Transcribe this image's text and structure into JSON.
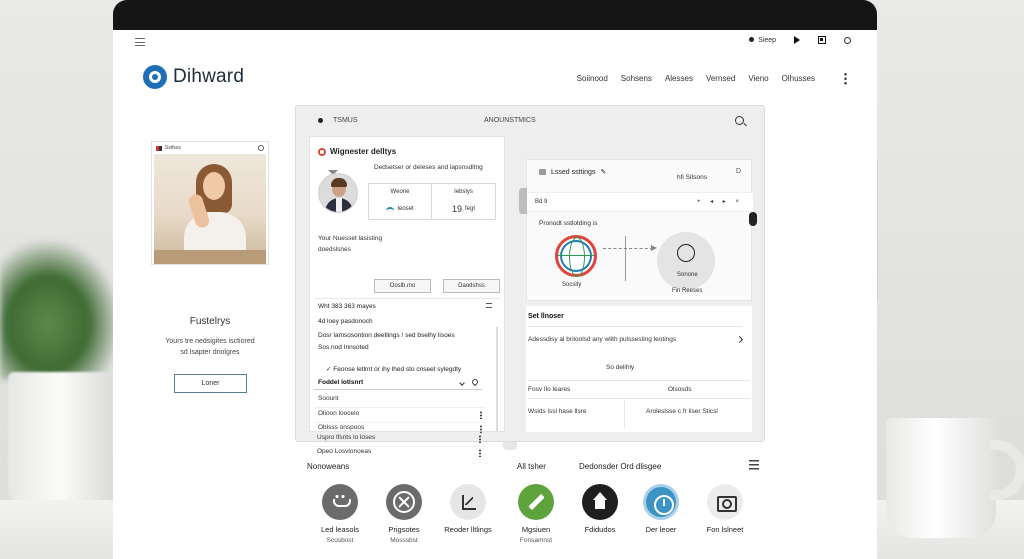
{
  "top_controls": {
    "status_label": "Sieep"
  },
  "header": {
    "brand": "Dihward",
    "nav": [
      "Soiinood",
      "Sohsens",
      "Alesses",
      "Vernsed",
      "Vieno",
      "Olhusses"
    ]
  },
  "profile": {
    "card_label": "Ssifsss",
    "name": "Fustelrys",
    "description_lines": [
      "Yours tre nedsigites isctiored",
      "sd lsapter driolgres"
    ],
    "button_label": "Loner"
  },
  "window": {
    "left_label": "TSMUS",
    "center_label": "ANOUNSTMICS",
    "left_pane": {
      "title": "Wignester delltys",
      "description": "Dedsetser or deleses and lapsnsdltng",
      "info": {
        "cell1": "Weone",
        "cell2": "Iebslys",
        "cell3": "Ieoset",
        "cell4_number": "19",
        "cell4": "fegt"
      },
      "sub_lines": [
        "Your Nuesset lasisting",
        "doedslsnes"
      ],
      "buttons": [
        "Ooslb.mo",
        "Daodshss"
      ],
      "line1": "Wht 383 363 mayes",
      "line2": "4d loey pasdonoch",
      "line3": "Dosr lamsosontion deetlings / sed bselhy lisoes",
      "line4": "Sos nod Innsoted",
      "check_line": "✓ Feonse letlmt or ihy lhed sto cnseet sylegdty",
      "select_label": "Foddel lotlsnrt",
      "list_rows": [
        "Soount",
        "Olioon loocelo",
        "Oblsss onspoos",
        "Uspro lfsnts lo loses",
        "Opeo Losvlonoeas"
      ]
    },
    "right_pane": {
      "title": "Lssed ssttings",
      "right_label": "hfi Sitsons",
      "corner_icon": "D",
      "sub_left": "Bd 9",
      "sub_right": "+ ◂ ▸ ×",
      "line": "Pronodt sstlotding is",
      "globe_label": "Socsity",
      "bulb_label": "Sonone",
      "foot_label": "Fin Reeses"
    },
    "lower_pane": {
      "title": "Set llnoser",
      "row": "Adessdisy al briloolsd any wlith pulssesting leotings",
      "center": "So delihly",
      "grid_head_left": "Fosv Ilo leares",
      "grid_head_right": "Olsosds",
      "grid_cell_left": "Wslds lssl hase llsre",
      "grid_cell_right": "Aroleslsse c fr liser Sticsl"
    }
  },
  "bottom": {
    "headings": [
      "Nonoweans",
      "All tsher",
      "Dedonsder Ord dlisgee"
    ],
    "apps": [
      {
        "name": "Led leasols",
        "sub": "Scosbost",
        "icon": "face-icon",
        "color": "#6b6b6b"
      },
      {
        "name": "Prigsotes",
        "sub": "Mosssbst",
        "icon": "close-icon",
        "color": "#6b6b6b"
      },
      {
        "name": "Reoder lltlings",
        "sub": "",
        "icon": "chart-icon",
        "color": "#e6e6e6"
      },
      {
        "name": "Mgsiuen",
        "sub": "Fonsamnst",
        "icon": "pencil-icon",
        "color": "#5ea33c"
      },
      {
        "name": "Fdidudos",
        "sub": "",
        "icon": "home-icon",
        "color": "#1f1f1f"
      },
      {
        "name": "Der leoer",
        "sub": "",
        "icon": "clock-icon",
        "color": "#3c93c4"
      },
      {
        "name": "Fon lslneet",
        "sub": "",
        "icon": "camera-icon",
        "color": "#ececec"
      }
    ]
  }
}
